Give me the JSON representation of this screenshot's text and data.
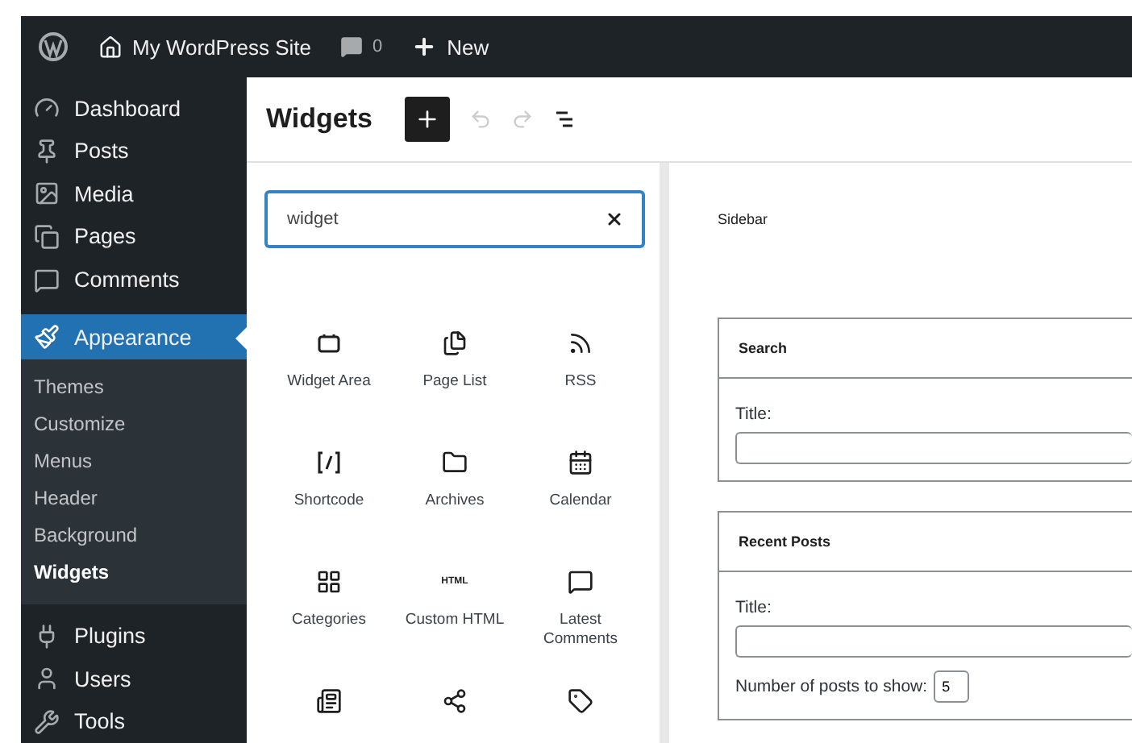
{
  "admin_bar": {
    "site_name": "My WordPress Site",
    "comments_count": "0",
    "new_label": "New"
  },
  "menu": [
    {
      "label": "Dashboard",
      "selected": false
    },
    {
      "label": "Posts",
      "selected": false
    },
    {
      "label": "Media",
      "selected": false
    },
    {
      "label": "Pages",
      "selected": false
    },
    {
      "label": "Comments",
      "selected": false
    },
    {
      "label": "Appearance",
      "selected": true,
      "children": [
        {
          "label": "Themes",
          "selected": false
        },
        {
          "label": "Customize",
          "selected": false
        },
        {
          "label": "Menus",
          "selected": false
        },
        {
          "label": "Header",
          "selected": false
        },
        {
          "label": "Background",
          "selected": false
        },
        {
          "label": "Widgets",
          "selected": true
        }
      ]
    },
    {
      "label": "Plugins",
      "selected": false
    },
    {
      "label": "Users",
      "selected": false
    },
    {
      "label": "Tools",
      "selected": false
    }
  ],
  "editor": {
    "title": "Widgets"
  },
  "inserter": {
    "search": {
      "value": "widget"
    },
    "blocks": [
      {
        "label": "Widget Area"
      },
      {
        "label": "Page List"
      },
      {
        "label": "RSS"
      },
      {
        "label": "Shortcode"
      },
      {
        "label": "Archives"
      },
      {
        "label": "Calendar"
      },
      {
        "label": "Categories"
      },
      {
        "label": "Custom HTML",
        "icon_text": "HTML"
      },
      {
        "label": "Latest Comments"
      }
    ]
  },
  "widget_area": {
    "title": "Sidebar",
    "widgets": [
      {
        "title": "Search",
        "fields": [
          {
            "label": "Title:",
            "kind": "text"
          }
        ]
      },
      {
        "title": "Recent Posts",
        "fields": [
          {
            "label": "Title:",
            "kind": "text"
          },
          {
            "label": "Number of posts to show:",
            "kind": "number",
            "value": "5"
          }
        ]
      }
    ]
  }
}
